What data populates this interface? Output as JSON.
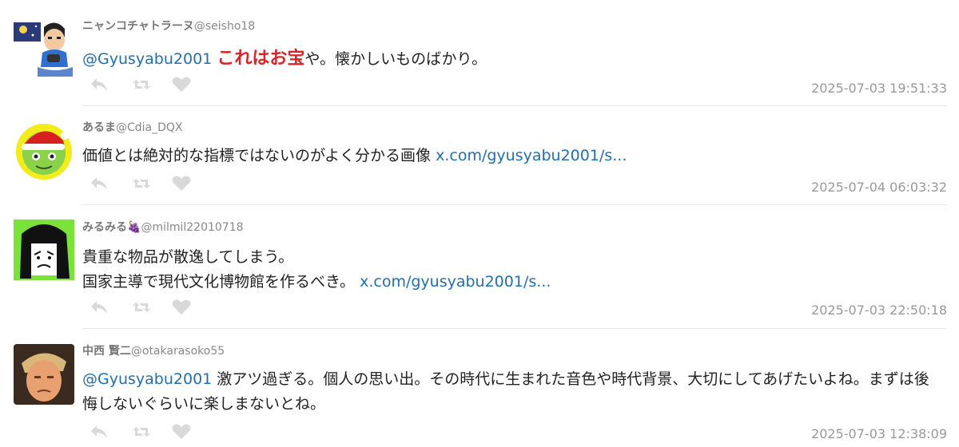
{
  "tweets": [
    {
      "display_name": "ニャンコチャトラーヌ",
      "handle": "@seisho18",
      "mention": "@Gyusyabu2001",
      "highlight": "これはお宝",
      "text": "や。懐かしいものばかり。",
      "line2": "",
      "link": "",
      "timestamp": "2025-07-03 19:51:33"
    },
    {
      "display_name": "あるま",
      "handle": "@Cdia_DQX",
      "mention": "",
      "highlight": "",
      "text": "価値とは絶対的な指標ではないのがよく分かる画像 ",
      "line2": "",
      "link": "x.com/gyusyabu2001/s...",
      "timestamp": "2025-07-04 06:03:32"
    },
    {
      "display_name": "みるみる",
      "emoji": "🍇",
      "handle": "@milmil22010718",
      "mention": "",
      "highlight": "",
      "text": "貴重な物品が散逸してしまう。",
      "line2": "国家主導で現代文化博物館を作るべき。 ",
      "link": "x.com/gyusyabu2001/s...",
      "timestamp": "2025-07-03 22:50:18"
    },
    {
      "display_name": "中西 賢二",
      "handle": "@otakarasoko55",
      "mention": "@Gyusyabu2001",
      "highlight": "",
      "text": " 激アツ過ぎる。個人の思い出。その時代に生まれた音色や時代背景、大切にしてあげたいよね。まずは後悔しないぐらいに楽しまないとね。",
      "line2": "",
      "link": "",
      "timestamp": "2025-07-03 12:38:09"
    }
  ],
  "icons": {
    "reply": "reply-icon",
    "retweet": "retweet-icon",
    "like": "heart-icon"
  },
  "colors": {
    "link": "#1f6fb2",
    "highlight": "#d92525",
    "meta": "#999999",
    "action": "#d9d9d9"
  }
}
